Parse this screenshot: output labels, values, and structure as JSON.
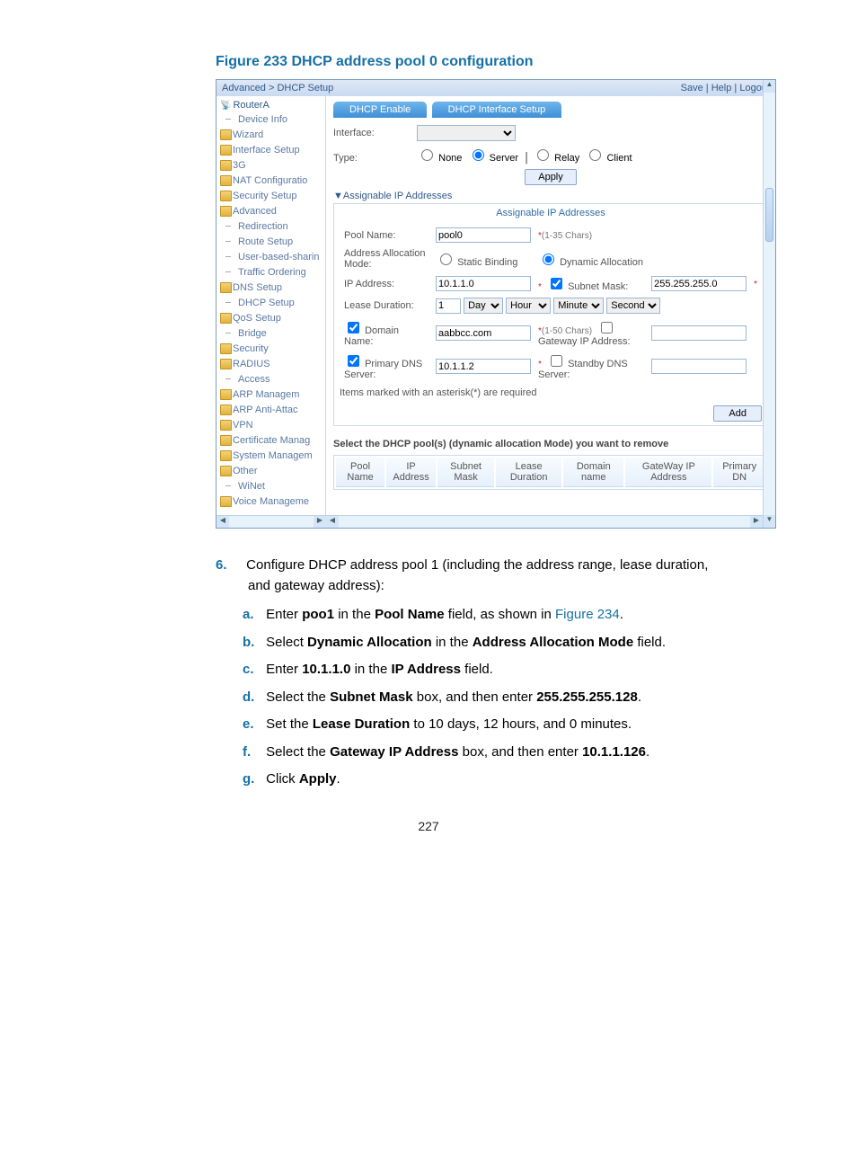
{
  "figure_caption": "Figure 233 DHCP address pool 0 configuration",
  "breadcrumb": "Advanced > DHCP Setup",
  "toplinks": {
    "save": "Save",
    "help": "Help",
    "logout": "Logout"
  },
  "router_name": "RouterA",
  "nav": {
    "device_info": "Device Info",
    "wizard": "Wizard",
    "interface_setup": "Interface Setup",
    "threeg": "3G",
    "nat": "NAT Configuratio",
    "security_setup": "Security Setup",
    "advanced": "Advanced",
    "redirection": "Redirection",
    "route_setup": "Route Setup",
    "user_based": "User-based-sharin",
    "traffic": "Traffic Ordering",
    "dns": "DNS Setup",
    "dhcp": "DHCP Setup",
    "qos": "QoS Setup",
    "bridge": "Bridge",
    "security": "Security",
    "radius": "RADIUS",
    "access": "Access",
    "arp_m": "ARP Managem",
    "arp_a": "ARP Anti-Attac",
    "vpn": "VPN",
    "cert": "Certificate Manag",
    "system": "System Managem",
    "other": "Other",
    "winet": "WiNet",
    "voice": "Voice Manageme"
  },
  "tabs": {
    "enable": "DHCP Enable",
    "iface": "DHCP Interface Setup"
  },
  "fields": {
    "interface_label": "Interface:",
    "type_label": "Type:",
    "type_none": "None",
    "type_server": "Server",
    "type_relay": "Relay",
    "type_client": "Client",
    "apply": "Apply"
  },
  "section": "Assignable IP Addresses",
  "panel": {
    "title": "Assignable IP Addresses",
    "pool_label": "Pool Name:",
    "pool_value": "pool0",
    "pool_hint": "(1-35 Chars)",
    "alloc_label": "Address Allocation Mode:",
    "alloc_static": "Static Binding",
    "alloc_dynamic": "Dynamic Allocation",
    "ip_label": "IP Address:",
    "ip_value": "10.1.1.0",
    "mask_label": "Subnet Mask:",
    "mask_value": "255.255.255.0",
    "lease_label": "Lease Duration:",
    "lease_day": "1",
    "day_unit": "Day",
    "hour_unit": "Hour",
    "minute_unit": "Minute",
    "second_unit": "Second",
    "domain_label": "Domain Name:",
    "domain_value": "aabbcc.com",
    "domain_hint": "(1-50 Chars)",
    "gateway_label": "Gateway IP Address:",
    "primary_dns_label": "Primary DNS Server:",
    "primary_dns_value": "10.1.1.2",
    "standby_dns_label": "Standby DNS Server:",
    "required_note": "Items marked with an asterisk(*) are required",
    "add": "Add",
    "remove_hint": "Select the DHCP pool(s) (dynamic allocation Mode) you want to remove"
  },
  "table": {
    "h1": "Pool Name",
    "h2": "IP Address",
    "h3": "Subnet Mask",
    "h4": "Lease Duration",
    "h5": "Domain name",
    "h6": "GateWay IP Address",
    "h7": "Primary DN"
  },
  "doc": {
    "step6_num": "6.",
    "step6_text_a": "Configure DHCP address pool 1 (including the address range, lease duration, and gateway address):",
    "a_letter": "a.",
    "a_text_1": "Enter ",
    "a_bold_1": "poo1",
    "a_text_2": " in the ",
    "a_bold_2": "Pool Name",
    "a_text_3": " field, as shown in ",
    "a_link": "Figure 234",
    "a_text_4": ".",
    "b_letter": "b.",
    "b_text_1": "Select ",
    "b_bold_1": "Dynamic Allocation",
    "b_text_2": " in the ",
    "b_bold_2": "Address Allocation Mode",
    "b_text_3": " field.",
    "c_letter": "c.",
    "c_text_1": "Enter ",
    "c_bold_1": "10.1.1.0",
    "c_text_2": " in the ",
    "c_bold_2": "IP Address",
    "c_text_3": " field.",
    "d_letter": "d.",
    "d_text_1": "Select the ",
    "d_bold_1": "Subnet Mask",
    "d_text_2": " box, and then enter ",
    "d_bold_2": "255.255.255.128",
    "d_text_3": ".",
    "e_letter": "e.",
    "e_text_1": "Set the ",
    "e_bold_1": "Lease Duration",
    "e_text_2": " to 10 days, 12 hours, and 0 minutes.",
    "f_letter": "f.",
    "f_text_1": "Select the ",
    "f_bold_1": "Gateway IP Address",
    "f_text_2": " box, and then enter ",
    "f_bold_2": "10.1.1.126",
    "f_text_3": ".",
    "g_letter": "g.",
    "g_text_1": "Click ",
    "g_bold_1": "Apply",
    "g_text_2": "."
  },
  "page_number": "227"
}
